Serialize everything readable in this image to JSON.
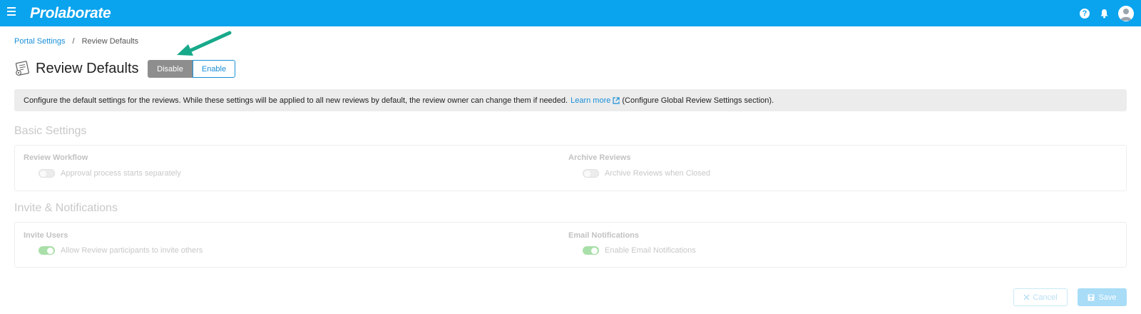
{
  "app": {
    "logo": "Prolaborate"
  },
  "breadcrumb": {
    "parent": "Portal Settings",
    "separator": "/",
    "current": "Review Defaults"
  },
  "page": {
    "title": "Review Defaults",
    "disable_label": "Disable",
    "enable_label": "Enable"
  },
  "info": {
    "text": "Configure the default settings for the reviews. While these settings will be applied to all new reviews by default, the review owner can change them if needed.",
    "link_label": "Learn more",
    "suffix": "(Configure Global Review Settings section)."
  },
  "basic": {
    "title": "Basic Settings",
    "workflow_label": "Review Workflow",
    "workflow_option": "Approval process starts separately",
    "workflow_on": false,
    "archive_label": "Archive Reviews",
    "archive_option": "Archive Reviews when Closed",
    "archive_on": false
  },
  "invite": {
    "title": "Invite & Notifications",
    "invite_label": "Invite Users",
    "invite_option": "Allow Review participants to invite others",
    "invite_on": true,
    "email_label": "Email Notifications",
    "email_option": "Enable Email Notifications",
    "email_on": true
  },
  "footer": {
    "cancel_label": "Cancel",
    "save_label": "Save"
  },
  "colors": {
    "topbar": "#0aa3ee",
    "link": "#1a8fd8",
    "arrow": "#17a98a",
    "switch_on": "#a9dfa8"
  },
  "icons": [
    "menu-icon",
    "help-icon",
    "bell-icon",
    "user-avatar-icon",
    "review-defaults-icon",
    "external-link-icon",
    "close-icon",
    "save-icon"
  ]
}
